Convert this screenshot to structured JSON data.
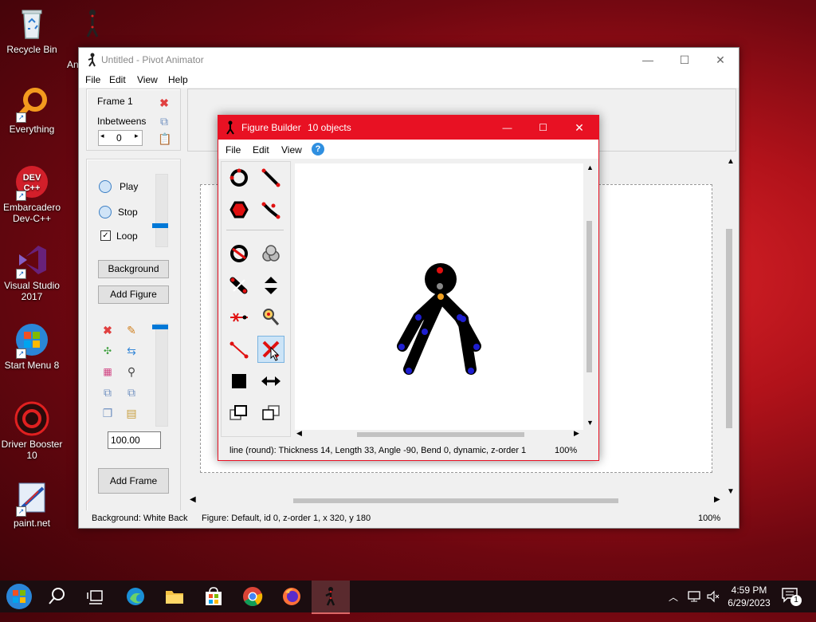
{
  "desktop": {
    "icons": [
      {
        "label": "Recycle Bin"
      },
      {
        "label": "Everything"
      },
      {
        "label": "Embarcadero Dev-C++"
      },
      {
        "label": "Visual Studio 2017"
      },
      {
        "label": "Start Menu 8"
      },
      {
        "label": "Driver Booster 10"
      },
      {
        "label": "paint.net"
      }
    ],
    "partial_icon_label": "An"
  },
  "main_window": {
    "title": "Untitled - Pivot Animator",
    "menu": [
      "File",
      "Edit",
      "View",
      "Help"
    ],
    "frame_label": "Frame 1",
    "inbetweens_label": "Inbetweens",
    "inbetweens_value": "0",
    "play_label": "Play",
    "stop_label": "Stop",
    "loop_label": "Loop",
    "loop_checked": true,
    "background_button": "Background",
    "add_figure_button": "Add Figure",
    "scale_value": "100.00",
    "add_frame_button": "Add Frame",
    "status_background": "Background: White Back",
    "status_figure": "Figure: Default,  id 0,  z-order 1,  x 320, y 180",
    "status_zoom": "100%"
  },
  "figure_builder": {
    "title": "Figure Builder",
    "objects": "10 objects",
    "menu": [
      "File",
      "Edit",
      "View"
    ],
    "help_icon": "?",
    "status_text": "line (round): Thickness 14, Length 33, Angle -90, Bend 0, dynamic, z-order 1",
    "status_zoom": "100%"
  },
  "taskbar": {
    "time": "4:59 PM",
    "date": "6/29/2023",
    "notification_count": "1"
  },
  "colors": {
    "accent_red": "#e81123",
    "handle_blue": "#1e1ed0",
    "handle_red": "#e01010",
    "handle_orange": "#f0a020"
  }
}
